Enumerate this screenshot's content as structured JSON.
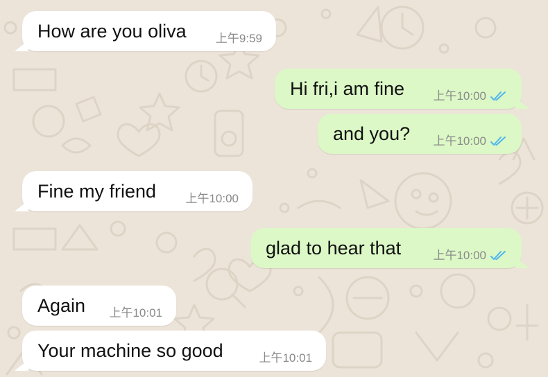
{
  "theme": {
    "chat_background": "#ece4d9",
    "incoming_bubble": "#ffffff",
    "outgoing_bubble": "#dcf8c6",
    "read_tick_color": "#4fb6ec"
  },
  "messages": [
    {
      "direction": "incoming",
      "text": "How are you oliva",
      "time": "上午9:59"
    },
    {
      "direction": "outgoing",
      "text": "Hi fri,i am fine",
      "time": "上午10:00",
      "status_icon": "double-check-read-icon"
    },
    {
      "direction": "outgoing",
      "text": "and you?",
      "time": "上午10:00",
      "status_icon": "double-check-read-icon"
    },
    {
      "direction": "incoming",
      "text": "Fine my friend",
      "time": "上午10:00"
    },
    {
      "direction": "outgoing",
      "text": "glad to hear that",
      "time": "上午10:00",
      "status_icon": "double-check-read-icon"
    },
    {
      "direction": "incoming",
      "text": "Again",
      "time": "上午10:01"
    },
    {
      "direction": "incoming",
      "text": "Your machine so good",
      "time": "上午10:01"
    }
  ]
}
